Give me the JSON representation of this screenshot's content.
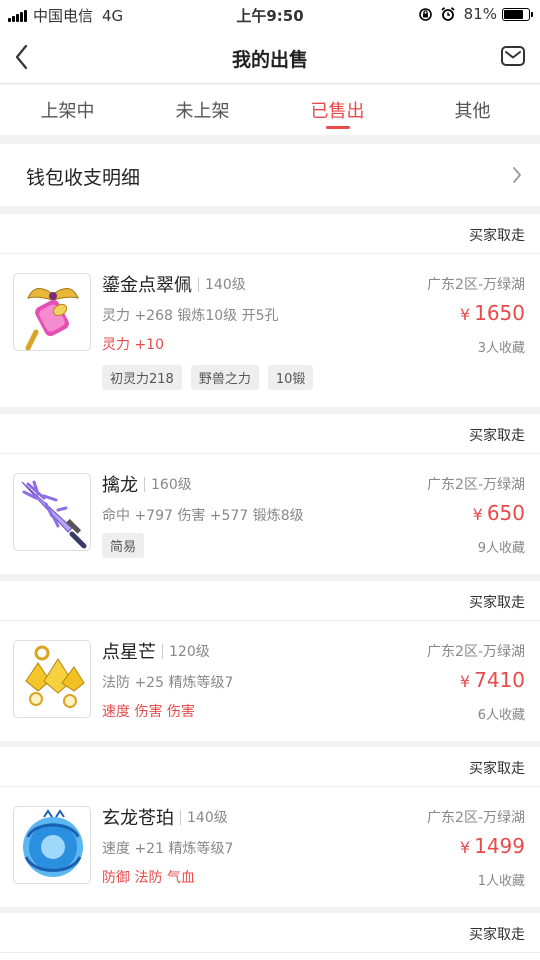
{
  "status_bar": {
    "carrier": "中国电信",
    "network": "4G",
    "time": "上午9:50",
    "battery": "81%",
    "battery_level": 0.81
  },
  "nav": {
    "title": "我的出售"
  },
  "tabs": [
    {
      "label": "上架中",
      "active": false
    },
    {
      "label": "未上架",
      "active": false
    },
    {
      "label": "已售出",
      "active": true
    },
    {
      "label": "其他",
      "active": false
    }
  ],
  "wallet": {
    "label": "钱包收支明细"
  },
  "listings": [
    {
      "status": "买家取走",
      "name": "鎏金点翠佩",
      "level": "140级",
      "attrs": "灵力 +268 锻炼10级 开5孔",
      "red_attrs": "灵力 +10",
      "tags": [
        "初灵力218",
        "野兽之力",
        "10锻"
      ],
      "server": "广东2区-万绿湖",
      "currency": "¥",
      "price": "1650",
      "favorites": "3人收藏",
      "icon": "golden-winged-pendant-icon"
    },
    {
      "status": "买家取走",
      "name": "擒龙",
      "level": "160级",
      "attrs": "命中 +797 伤害 +577 锻炼8级",
      "red_attrs": "",
      "tags": [
        "简易"
      ],
      "server": "广东2区-万绿湖",
      "currency": "¥",
      "price": "650",
      "favorites": "9人收藏",
      "icon": "purple-sword-icon"
    },
    {
      "status": "买家取走",
      "name": "点星芒",
      "level": "120级",
      "attrs": "法防 +25 精炼等级7",
      "red_attrs": "速度 伤害 伤害",
      "tags": [],
      "server": "广东2区-万绿湖",
      "currency": "¥",
      "price": "7410",
      "favorites": "6人收藏",
      "icon": "golden-star-earring-icon"
    },
    {
      "status": "买家取走",
      "name": "玄龙苍珀",
      "level": "140级",
      "attrs": "速度 +21 精炼等级7",
      "red_attrs": "防御 法防 气血",
      "tags": [],
      "server": "广东2区-万绿湖",
      "currency": "¥",
      "price": "1499",
      "favorites": "1人收藏",
      "icon": "blue-dragon-amulet-icon"
    },
    {
      "status": "买家取走"
    }
  ],
  "colors": {
    "accent": "#e84b4b",
    "background": "#f2f2f2"
  }
}
